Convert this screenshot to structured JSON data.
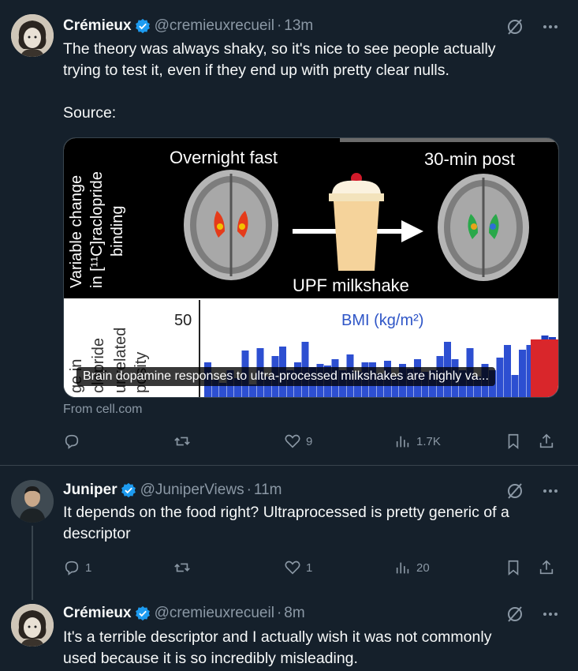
{
  "tweet1": {
    "author": "Crémieux",
    "handle": "@cremieuxrecueil",
    "separator": "·",
    "time": "13m",
    "text_line1": "The theory was always shaky, so it's nice to see people actually",
    "text_line2": "trying to test it, even if they end up with pretty clear nulls.",
    "text_line3": "Source:",
    "card": {
      "ylabel_line1": "Variable change",
      "ylabel_line2": "in [¹¹C]raclopride",
      "ylabel_line3": "binding",
      "label_left": "Overnight fast",
      "label_right": "30-min post",
      "label_center": "UPF milkshake",
      "chart_tick": "50",
      "chart_legend": "BMI (kg/m²)",
      "chart_side_1": "ge in",
      "chart_side_2": "clopride",
      "chart_side_3": "unrelated",
      "chart_side_4": "posity",
      "title": "Brain dopamine responses to ultra-processed milkshakes are highly va..."
    },
    "from": "From cell.com",
    "likes": "9",
    "views": "1.7K"
  },
  "tweet2": {
    "author": "Juniper",
    "handle": "@JuniperViews",
    "separator": "·",
    "time": "11m",
    "text_line1": "It depends on the food right? Ultraprocessed is pretty generic of a",
    "text_line2": "descriptor",
    "replies": "1",
    "likes": "1",
    "views": "20"
  },
  "tweet3": {
    "author": "Crémieux",
    "handle": "@cremieuxrecueil",
    "separator": "·",
    "time": "8m",
    "text_line1": "It's a terrible descriptor and I actually wish it was not commonly",
    "text_line2": "used because it is so incredibly misleading."
  },
  "colors": {
    "background": "#15202b",
    "text": "#f7f9f9",
    "muted": "#8b98a5",
    "verified": "#1d9bf0",
    "border": "#38444d"
  },
  "icons": [
    "verified-badge-icon",
    "grok-icon",
    "more-icon",
    "reply-icon",
    "retweet-icon",
    "like-icon",
    "views-icon",
    "bookmark-icon",
    "share-icon"
  ]
}
